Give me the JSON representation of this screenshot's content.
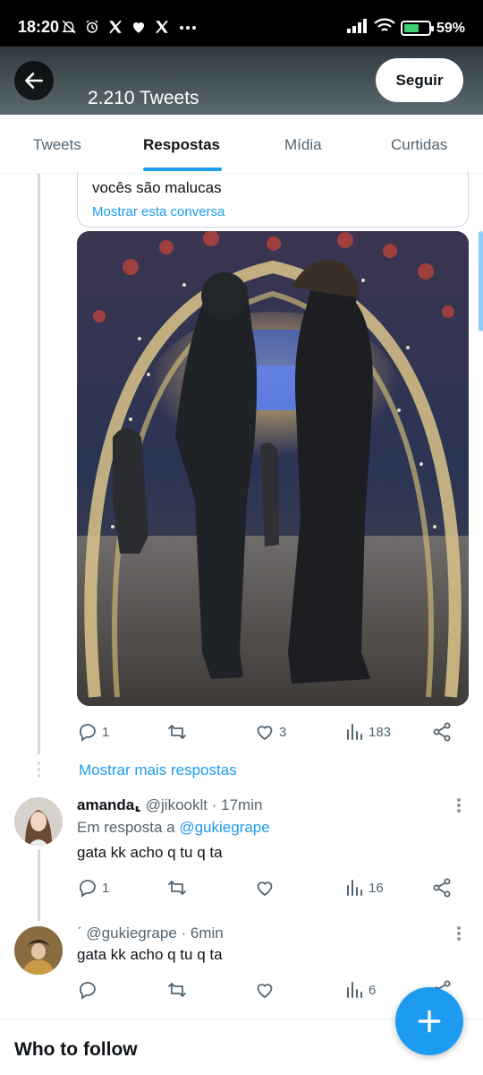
{
  "status_bar": {
    "time": "18:20",
    "notification_icons": [
      "mute-bell-icon",
      "alarm-icon",
      "x-logo-icon",
      "heart-icon",
      "x-logo-icon",
      "more-dots-icon"
    ],
    "battery": "59%"
  },
  "header": {
    "tweet_count": "2.210 Tweets",
    "follow_label": "Seguir"
  },
  "tabs": [
    {
      "label": "Tweets",
      "active": false
    },
    {
      "label": "Respostas",
      "active": true
    },
    {
      "label": "Mídia",
      "active": false
    },
    {
      "label": "Curtidas",
      "active": false
    }
  ],
  "quoted_tweet": {
    "text": "vocês são malucas",
    "show_thread": "Mostrar esta conversa"
  },
  "main_tweet": {
    "replies": "1",
    "retweets": "",
    "likes": "3",
    "views": "183"
  },
  "show_more_replies": "Mostrar mais respostas",
  "reply_1": {
    "name": "amanda⸤",
    "handle": "@jikooklt",
    "time": "· 17min",
    "reply_to_prefix": "Em resposta a",
    "reply_to_user": "@gukiegrape",
    "text": "gata kk acho q tu q ta",
    "replies": "1",
    "views": "16"
  },
  "reply_2": {
    "name": "ˊ",
    "handle": "@gukiegrape",
    "time": "· 6min",
    "text": "gata kk acho q tu q ta",
    "views": "6"
  },
  "who_to_follow": "Who to follow",
  "colors": {
    "accent": "#1d9bf0",
    "muted": "#536471",
    "text": "#0f1419"
  }
}
